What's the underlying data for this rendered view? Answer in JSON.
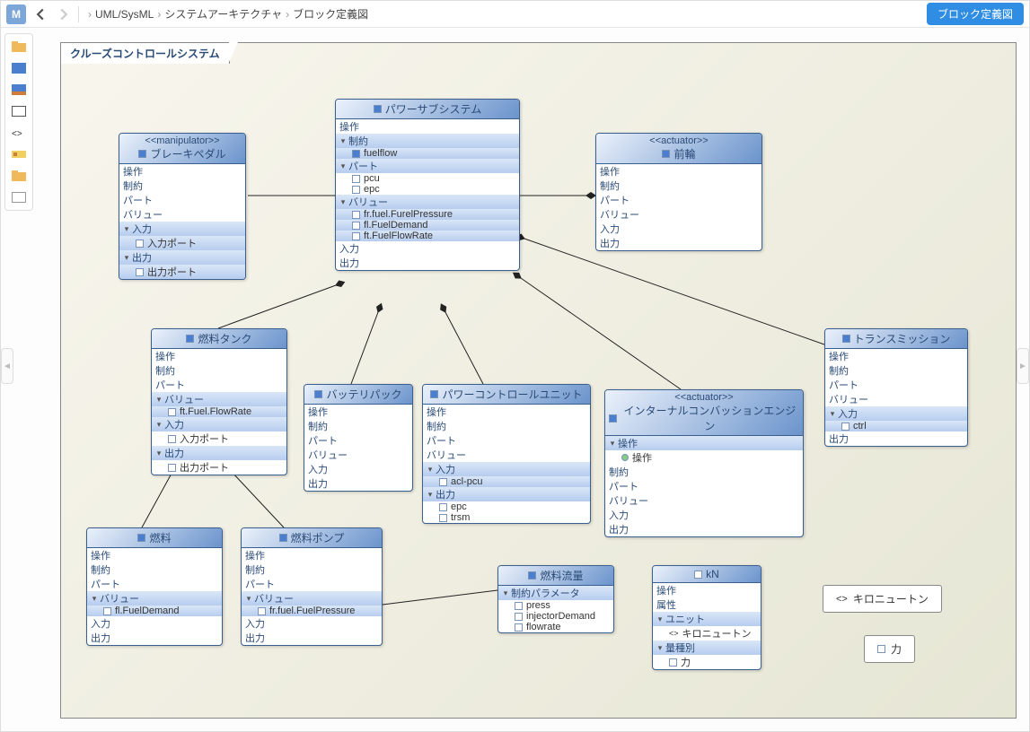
{
  "header": {
    "app_letter": "M",
    "breadcrumb": [
      "UML/SysML",
      "システムアーキテクチャ",
      "ブロック定義図"
    ],
    "top_right_button": "ブロック定義図"
  },
  "diagram": {
    "title": "クルーズコントロールシステム"
  },
  "blocks": {
    "brake": {
      "stereo": "<<manipulator>>",
      "title": "ブレーキペダル",
      "labels": {
        "op": "操作",
        "con": "制約",
        "part": "パート",
        "val": "バリュー",
        "in": "入力",
        "out": "出力"
      },
      "in_items": [
        "入力ポート"
      ],
      "out_items": [
        "出力ポート"
      ]
    },
    "power": {
      "title": "パワーサブシステム",
      "labels": {
        "op": "操作",
        "con": "制約",
        "part": "パート",
        "val": "バリュー",
        "in": "入力",
        "out": "出力"
      },
      "con_items": [
        "fuelflow"
      ],
      "part_items": [
        "pcu",
        "epc"
      ],
      "val_items": [
        "fr.fuel.FurelPressure",
        "fl.FuelDemand",
        "ft.FuelFlowRate"
      ]
    },
    "frontwheel": {
      "stereo": "<<actuator>>",
      "title": "前輪",
      "labels": {
        "op": "操作",
        "con": "制約",
        "part": "パート",
        "val": "バリュー",
        "in": "入力",
        "out": "出力"
      }
    },
    "transmission": {
      "title": "トランスミッション",
      "labels": {
        "op": "操作",
        "con": "制約",
        "part": "パート",
        "val": "バリュー",
        "in": "入力",
        "out": "出力"
      },
      "in_items": [
        "ctrl"
      ]
    },
    "fueltank": {
      "title": "燃料タンク",
      "labels": {
        "op": "操作",
        "con": "制約",
        "part": "パート",
        "val": "バリュー",
        "in": "入力",
        "out": "出力"
      },
      "val_items": [
        "ft.Fuel.FlowRate"
      ],
      "in_items": [
        "入力ポート"
      ],
      "out_items": [
        "出力ポート"
      ]
    },
    "battery": {
      "title": "バッテリパック",
      "labels": {
        "op": "操作",
        "con": "制約",
        "part": "パート",
        "val": "バリュー",
        "in": "入力",
        "out": "出力"
      }
    },
    "pcu": {
      "title": "パワーコントロールユニット",
      "labels": {
        "op": "操作",
        "con": "制約",
        "part": "パート",
        "val": "バリュー",
        "in": "入力",
        "out": "出力"
      },
      "in_items": [
        "acl-pcu"
      ],
      "out_items": [
        "epc",
        "trsm"
      ]
    },
    "engine": {
      "stereo": "<<actuator>>",
      "title": "インターナルコンバッションエンジン",
      "labels": {
        "op": "操作",
        "con": "制約",
        "part": "パート",
        "val": "バリュー",
        "in": "入力",
        "out": "出力"
      },
      "op_items": [
        "操作"
      ]
    },
    "fuel": {
      "title": "燃料",
      "labels": {
        "op": "操作",
        "con": "制約",
        "part": "パート",
        "val": "バリュー",
        "in": "入力",
        "out": "出力"
      },
      "val_items": [
        "fl.FuelDemand"
      ]
    },
    "fuelpump": {
      "title": "燃料ポンプ",
      "labels": {
        "op": "操作",
        "con": "制約",
        "part": "パート",
        "val": "バリュー",
        "in": "入力",
        "out": "出力"
      },
      "val_items": [
        "fr.fuel.FuelPressure"
      ]
    },
    "fuelflow": {
      "title": "燃料流量",
      "labels": {
        "param": "制約パラメータ"
      },
      "param_items": [
        "press",
        "injectorDemand",
        "flowrate"
      ]
    },
    "kn": {
      "title": "kN",
      "labels": {
        "op": "操作",
        "attr": "属性",
        "unit": "ユニット",
        "qty": "量種別"
      },
      "unit_items": [
        "キロニュートン"
      ],
      "qty_items": [
        "力"
      ]
    }
  },
  "chips": {
    "kilonewton": "キロニュートン",
    "force": "力"
  }
}
